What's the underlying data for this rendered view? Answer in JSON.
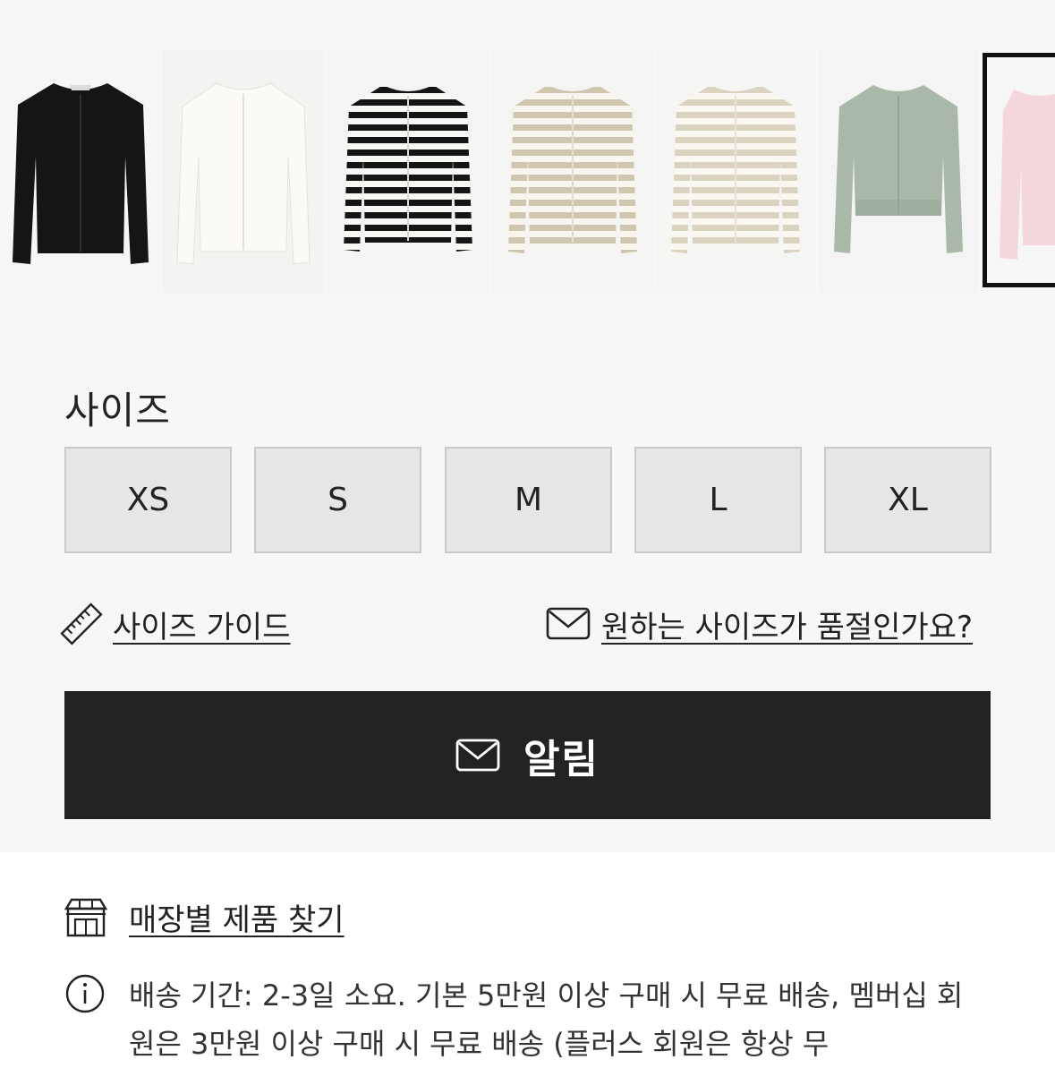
{
  "colors": {
    "panel_bg": "#f8f7f5",
    "button_dark": "#222222",
    "size_button_bg": "#e6e6e6",
    "swatch_colors": [
      "#111111",
      "#f4f2ec",
      "striped-black-white",
      "striped-beige",
      "striped-cream",
      "#a9b8a8",
      "#f3d7dc"
    ]
  },
  "swatches": [
    {
      "name": "black-cardigan"
    },
    {
      "name": "white-cardigan"
    },
    {
      "name": "black-striped-cardigan"
    },
    {
      "name": "beige-striped-cardigan"
    },
    {
      "name": "cream-striped-cardigan"
    },
    {
      "name": "sage-green-cardigan"
    },
    {
      "name": "light-pink-cardigan",
      "selected": true
    }
  ],
  "size_section": {
    "label": "사이즈",
    "sizes": [
      "XS",
      "S",
      "M",
      "L",
      "XL"
    ]
  },
  "links": {
    "size_guide": {
      "label": "사이즈 가이드",
      "icon": "ruler-icon"
    },
    "sold_out": {
      "label": "원하는 사이즈가 품절인가요?",
      "icon": "envelope-icon"
    }
  },
  "notify_button": {
    "label": "알림",
    "icon": "envelope-icon"
  },
  "store_finder": {
    "label": "매장별 제품 찾기",
    "icon": "store-icon"
  },
  "delivery_info": {
    "icon": "info-icon",
    "text": "배송 기간: 2-3일 소요. 기본 5만원 이상 구매 시 무료 배송, 멤버십 회원은 3만원 이상 구매 시 무료 배송 (플러스 회원은 항상 무"
  }
}
